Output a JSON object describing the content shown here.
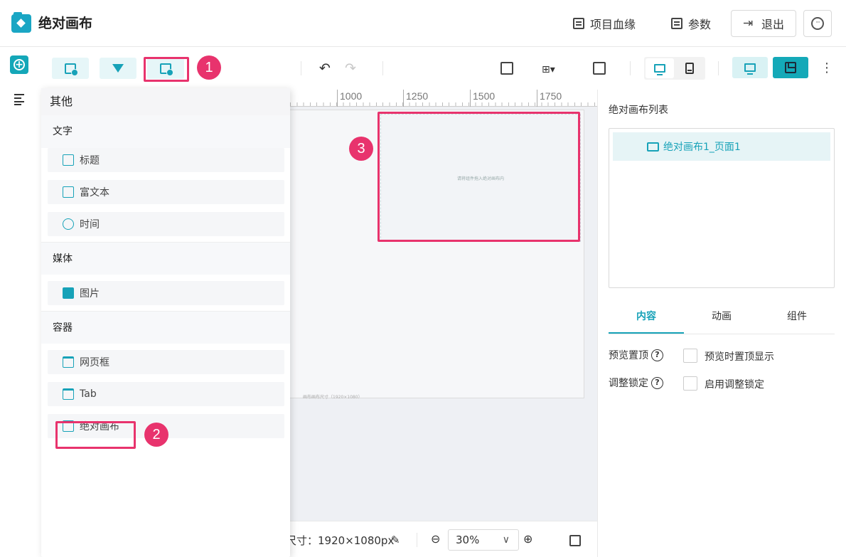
{
  "header": {
    "title": "绝对画布",
    "lineage_label": "项目血缘",
    "params_label": "参数",
    "exit_label": "退出"
  },
  "ruler": {
    "ticks": [
      "1000",
      "1250",
      "1500",
      "1750"
    ]
  },
  "canvas": {
    "placeholder": "请将组件拖入绝对画布内",
    "page_size_hint": "画布画布尺寸（1920×1080）"
  },
  "bottombar": {
    "size_label": "尺寸：",
    "size_value": "1920×1080px",
    "zoom": "30%"
  },
  "component_menu": {
    "category": "其他",
    "sections": [
      {
        "name": "文字",
        "items": [
          "标题",
          "富文本",
          "时间"
        ]
      },
      {
        "name": "媒体",
        "items": [
          "图片"
        ]
      },
      {
        "name": "容器",
        "items": [
          "网页框",
          "Tab",
          "绝对画布"
        ]
      }
    ]
  },
  "right_panel": {
    "list_title": "绝对画布列表",
    "list_item": "绝对画布1_页面1",
    "tabs": [
      "内容",
      "动画",
      "组件"
    ],
    "preview_pin_label": "预览置顶",
    "preview_pin_checkbox": "预览时置顶显示",
    "lock_label": "调整锁定",
    "lock_checkbox": "启用调整锁定"
  },
  "annotations": [
    "1",
    "2",
    "3"
  ],
  "colors": {
    "accent": "#17a2b8",
    "annotation": "#e8336d"
  }
}
